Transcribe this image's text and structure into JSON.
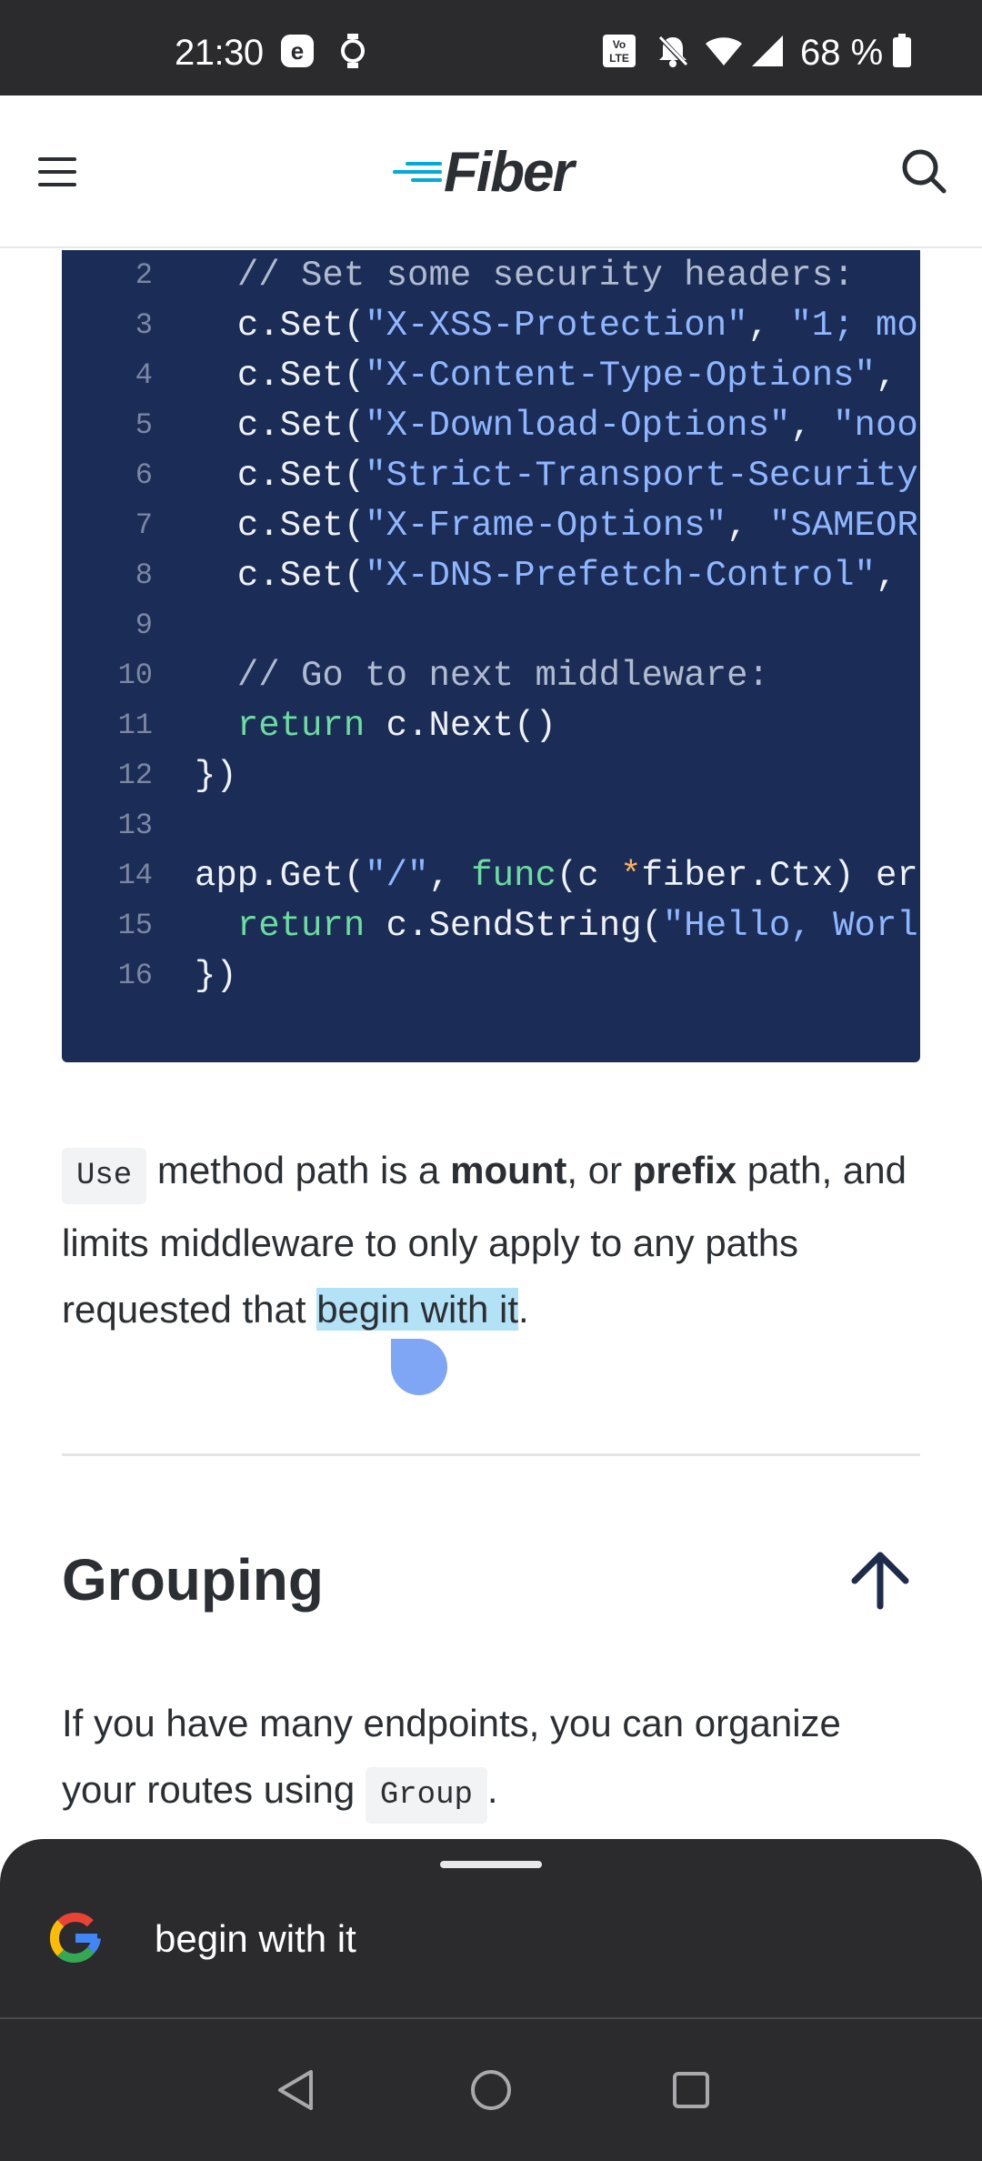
{
  "status_bar": {
    "time": "21:30",
    "battery": "68 %",
    "icons": [
      "e-badge-icon",
      "watch-icon",
      "volte-icon",
      "bell-off-icon",
      "wifi-icon",
      "signal-icon",
      "battery-icon"
    ]
  },
  "header": {
    "logo_text": "Fiber",
    "menu_icon": "hamburger-menu-icon",
    "search_icon": "search-icon"
  },
  "code": {
    "lines": [
      {
        "num": "2",
        "indent": "  ",
        "segments": [
          {
            "t": "// Set some security headers:",
            "c": "comment"
          }
        ]
      },
      {
        "num": "3",
        "indent": "  ",
        "segments": [
          {
            "t": "c.Set(",
            "c": "plain"
          },
          {
            "t": "\"X-XSS-Protection\"",
            "c": "string"
          },
          {
            "t": ", ",
            "c": "plain"
          },
          {
            "t": "\"1; mo",
            "c": "string"
          }
        ]
      },
      {
        "num": "4",
        "indent": "  ",
        "segments": [
          {
            "t": "c.Set(",
            "c": "plain"
          },
          {
            "t": "\"X-Content-Type-Options\"",
            "c": "string"
          },
          {
            "t": ",",
            "c": "plain"
          }
        ]
      },
      {
        "num": "5",
        "indent": "  ",
        "segments": [
          {
            "t": "c.Set(",
            "c": "plain"
          },
          {
            "t": "\"X-Download-Options\"",
            "c": "string"
          },
          {
            "t": ", ",
            "c": "plain"
          },
          {
            "t": "\"noo",
            "c": "string"
          }
        ]
      },
      {
        "num": "6",
        "indent": "  ",
        "segments": [
          {
            "t": "c.Set(",
            "c": "plain"
          },
          {
            "t": "\"Strict-Transport-Security",
            "c": "string"
          }
        ]
      },
      {
        "num": "7",
        "indent": "  ",
        "segments": [
          {
            "t": "c.Set(",
            "c": "plain"
          },
          {
            "t": "\"X-Frame-Options\"",
            "c": "string"
          },
          {
            "t": ", ",
            "c": "plain"
          },
          {
            "t": "\"SAMEOR",
            "c": "string"
          }
        ]
      },
      {
        "num": "8",
        "indent": "  ",
        "segments": [
          {
            "t": "c.Set(",
            "c": "plain"
          },
          {
            "t": "\"X-DNS-Prefetch-Control\"",
            "c": "string"
          },
          {
            "t": ",",
            "c": "plain"
          }
        ]
      },
      {
        "num": "9",
        "indent": "",
        "segments": []
      },
      {
        "num": "10",
        "indent": "  ",
        "segments": [
          {
            "t": "// Go to next middleware:",
            "c": "comment"
          }
        ]
      },
      {
        "num": "11",
        "indent": "  ",
        "segments": [
          {
            "t": "return",
            "c": "keyword"
          },
          {
            "t": " c.Next()",
            "c": "plain"
          }
        ]
      },
      {
        "num": "12",
        "indent": "",
        "segments": [
          {
            "t": "})",
            "c": "plain"
          }
        ]
      },
      {
        "num": "13",
        "indent": "",
        "segments": []
      },
      {
        "num": "14",
        "indent": "",
        "segments": [
          {
            "t": "app.Get(",
            "c": "plain"
          },
          {
            "t": "\"/\"",
            "c": "string"
          },
          {
            "t": ", ",
            "c": "plain"
          },
          {
            "t": "func",
            "c": "keyword"
          },
          {
            "t": "(c ",
            "c": "plain"
          },
          {
            "t": "*",
            "c": "op"
          },
          {
            "t": "fiber.Ctx) er",
            "c": "plain"
          }
        ]
      },
      {
        "num": "15",
        "indent": "  ",
        "segments": [
          {
            "t": "return",
            "c": "keyword"
          },
          {
            "t": " c.SendString(",
            "c": "plain"
          },
          {
            "t": "\"Hello, Worl",
            "c": "string"
          }
        ]
      },
      {
        "num": "16",
        "indent": "",
        "segments": [
          {
            "t": "})",
            "c": "plain"
          }
        ]
      }
    ]
  },
  "paragraph1": {
    "code": "Use",
    "t1": " method path is a ",
    "b1": "mount",
    "t2": ", or ",
    "b2": "prefix",
    "t3": " path, and limits middleware to only apply to any paths requested that ",
    "highlight": "begin with it",
    "t4": "."
  },
  "section": {
    "title": "Grouping",
    "back_to_top_icon": "arrow-up-icon"
  },
  "paragraph2": {
    "t1": "If you have many endpoints, you can organize your routes using ",
    "code": "Group",
    "t2": "."
  },
  "sheet": {
    "query": "begin with it",
    "logo_icon": "google-g-icon"
  },
  "nav": {
    "icons": [
      "back-icon",
      "home-icon",
      "recents-icon"
    ]
  },
  "colors": {
    "code_bg": "#1b2d57",
    "highlight": "#b3e2f7",
    "brand": "#00acd7"
  }
}
